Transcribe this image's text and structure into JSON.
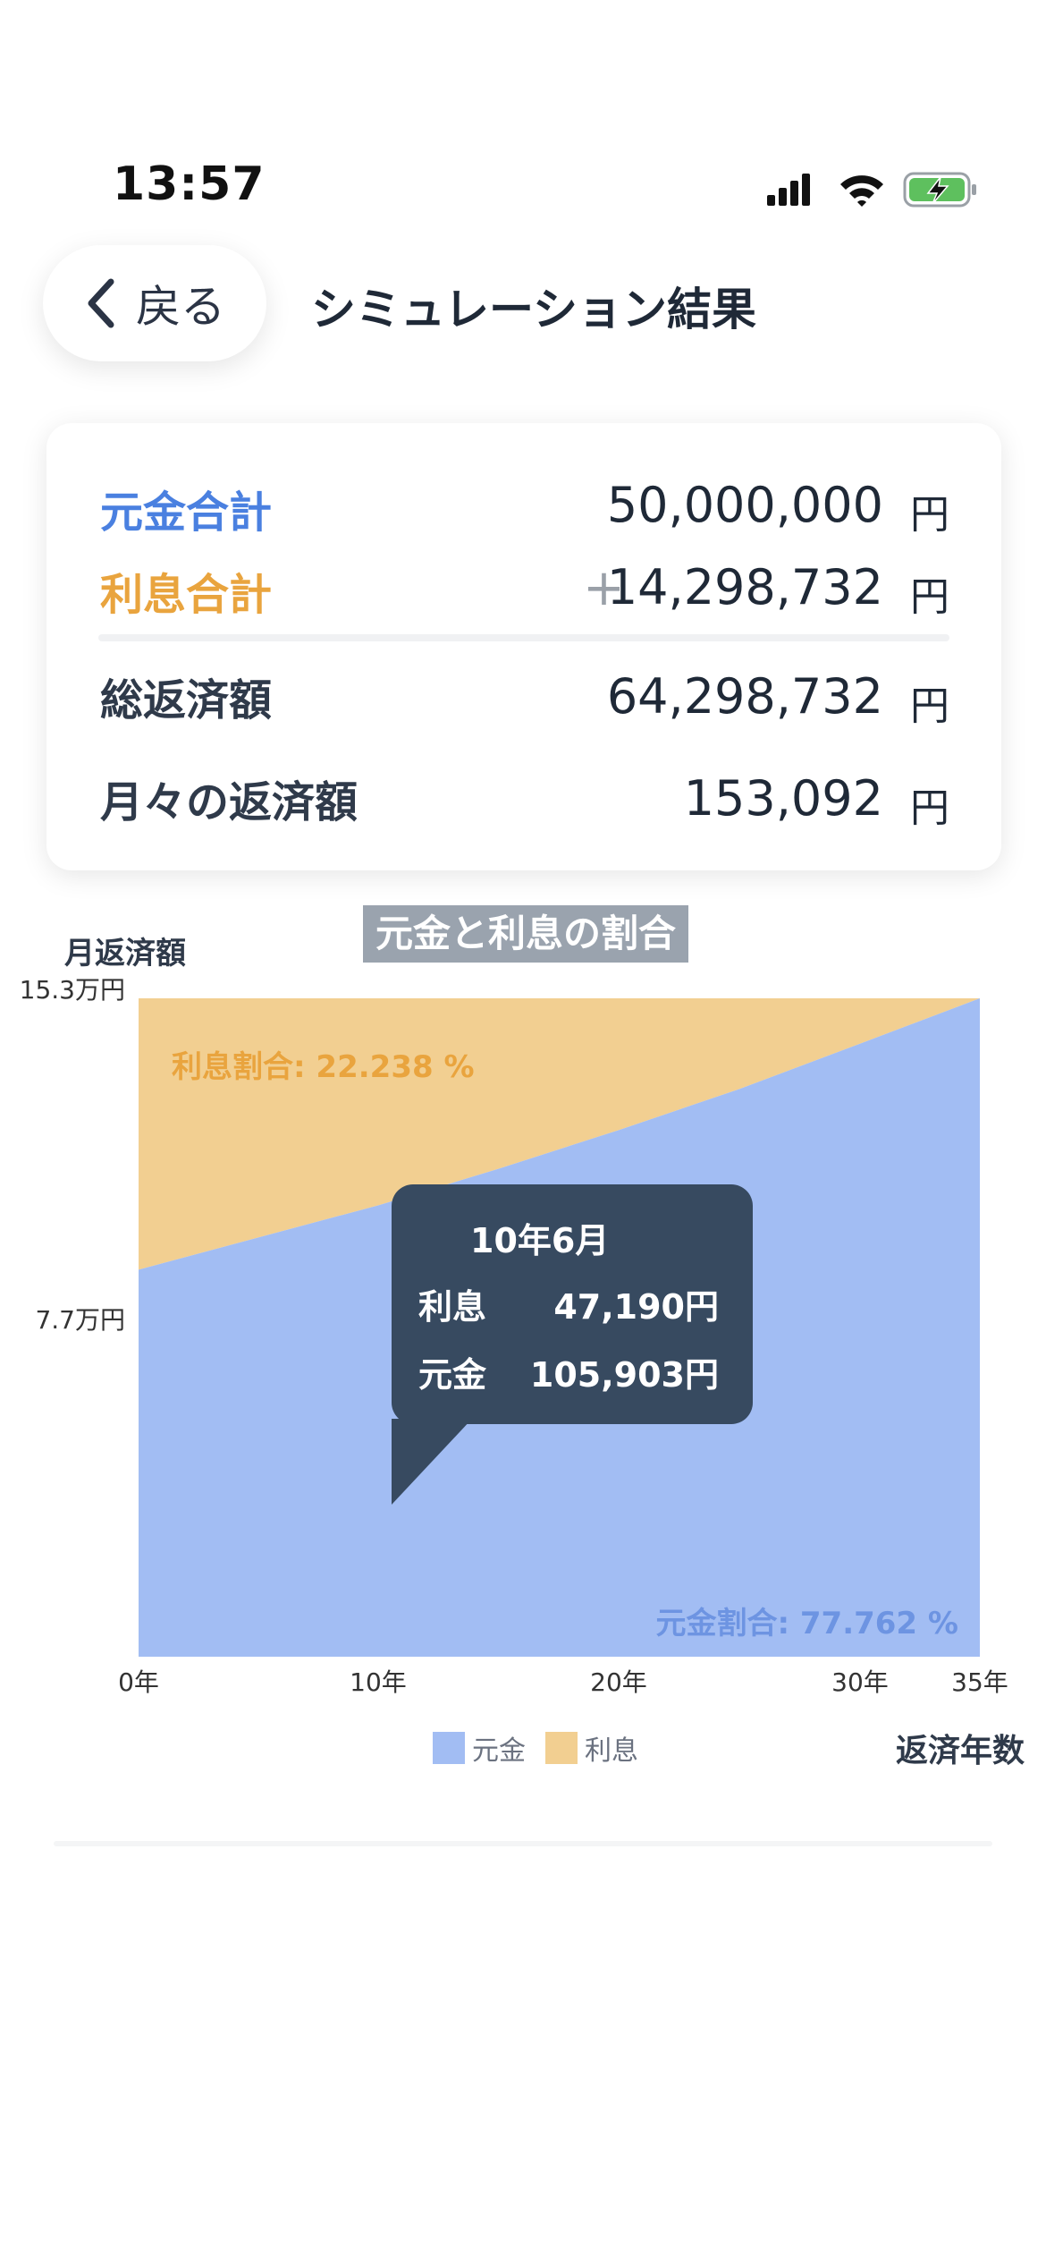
{
  "status_bar": {
    "time": "13:57"
  },
  "header": {
    "back_label": "戻る",
    "title": "シミュレーション結果"
  },
  "summary": {
    "principal_total": {
      "label": "元金合計",
      "value": "50,000,000",
      "unit": "円"
    },
    "interest_total": {
      "label": "利息合計",
      "prefix": "+",
      "value": "14,298,732",
      "unit": "円"
    },
    "grand_total": {
      "label": "総返済額",
      "value": "64,298,732",
      "unit": "円"
    },
    "monthly": {
      "label": "月々の返済額",
      "value": "153,092",
      "unit": "円"
    }
  },
  "chart": {
    "title": "元金と利息の割合",
    "y_axis_title": "月返済額",
    "x_axis_title": "返済年数",
    "y_ticks": [
      "15.3万円",
      "7.7万円"
    ],
    "x_ticks": [
      "0年",
      "10年",
      "20年",
      "30年",
      "35年"
    ],
    "interest_ratio_label": "利息割合: 22.238 %",
    "principal_ratio_label": "元金割合: 77.762 %",
    "legend": {
      "principal": "元金",
      "interest": "利息"
    },
    "tooltip": {
      "date": "10年6月",
      "interest_label": "利息",
      "interest_value": "47,190円",
      "principal_label": "元金",
      "principal_value": "105,903円"
    },
    "colors": {
      "principal": "#a2bdf3",
      "interest": "#f2cf91",
      "principal_text": "#6d94e2",
      "interest_text": "#e9a43e"
    }
  },
  "chart_data": {
    "type": "area",
    "title": "元金と利息の割合",
    "xlabel": "返済年数",
    "ylabel": "月返済額",
    "xlim": [
      0,
      35
    ],
    "ylim": [
      0,
      153092
    ],
    "x": [
      0,
      5,
      10,
      15,
      20,
      25,
      30,
      35
    ],
    "series": [
      {
        "name": "元金",
        "values": [
          90000,
          97500,
          105000,
          113500,
          122500,
          132000,
          142500,
          153092
        ]
      },
      {
        "name": "利息",
        "values": [
          63092,
          55592,
          48092,
          39592,
          30592,
          21092,
          10592,
          0
        ]
      }
    ],
    "grid": false,
    "legend": "bottom"
  }
}
